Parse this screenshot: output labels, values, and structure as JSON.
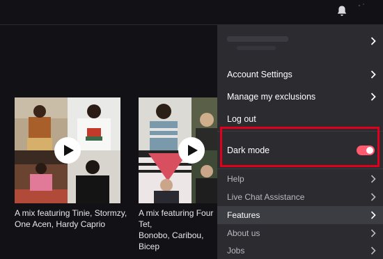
{
  "colors": {
    "accent": "#ff5a6e",
    "highlight_border": "#e0001b",
    "menu_bg": "#2b2b30",
    "page_bg": "#121216"
  },
  "header": {
    "bell_icon": "bell-icon"
  },
  "cards": [
    {
      "title": "A mix featuring Tinie, Stormzy,\nOne Acen, Hardy Caprio"
    },
    {
      "title": "A mix featuring Four Tet,\nBonobo, Caribou, Bicep"
    }
  ],
  "menu": {
    "account_settings": "Account Settings",
    "manage_exclusions": "Manage my exclusions",
    "log_out": "Log out",
    "dark_mode": "Dark mode",
    "dark_mode_enabled": true,
    "help": "Help",
    "live_chat": "Live Chat Assistance",
    "features": "Features",
    "about_us": "About us",
    "jobs": "Jobs"
  }
}
